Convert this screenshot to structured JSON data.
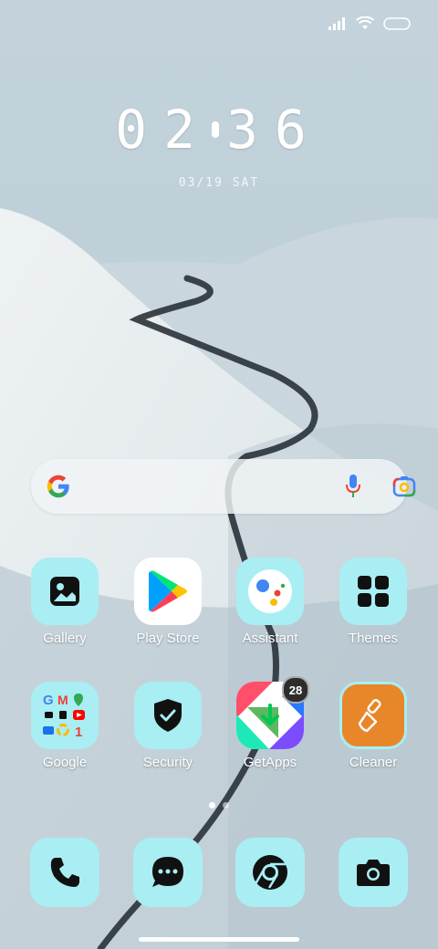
{
  "status_bar": {
    "signal_icon": "signal-icon",
    "wifi_icon": "wifi-icon",
    "battery_icon": "battery-icon"
  },
  "clock": {
    "hours": "02",
    "minutes": "36"
  },
  "date": "03/19 SAT",
  "search": {
    "google_icon": "google-g-icon",
    "mic_icon": "microphone-icon",
    "lens_icon": "google-lens-icon"
  },
  "apps_row1": [
    {
      "label": "Gallery",
      "icon": "gallery-icon"
    },
    {
      "label": "Play Store",
      "icon": "play-store-icon"
    },
    {
      "label": "Assistant",
      "icon": "assistant-icon"
    },
    {
      "label": "Themes",
      "icon": "themes-grid-icon"
    }
  ],
  "apps_row2": [
    {
      "label": "Google",
      "icon": "google-folder-icon"
    },
    {
      "label": "Security",
      "icon": "security-shield-icon"
    },
    {
      "label": "GetApps",
      "icon": "getapps-icon",
      "badge": "28"
    },
    {
      "label": "Cleaner",
      "icon": "cleaner-broom-icon"
    }
  ],
  "dock": [
    {
      "icon": "phone-icon"
    },
    {
      "icon": "messages-icon"
    },
    {
      "icon": "chrome-icon"
    },
    {
      "icon": "camera-icon"
    }
  ],
  "colors": {
    "tile": "#a8eef3",
    "cleaner": "#e8872a",
    "badge": "#2d2d2d"
  }
}
